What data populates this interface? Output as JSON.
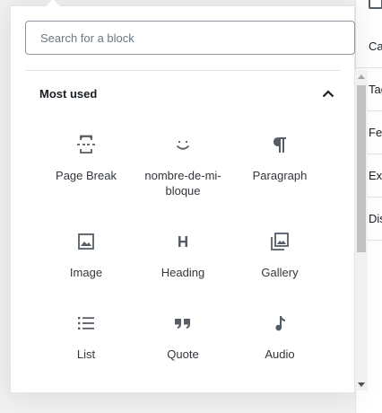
{
  "search": {
    "placeholder": "Search for a block",
    "value": ""
  },
  "panel": {
    "title": "Most used",
    "expanded": true
  },
  "blocks": [
    {
      "label": "Page Break",
      "icon": "page-break-icon"
    },
    {
      "label": "nombre-de-mi-bloque",
      "icon": "smiley-icon"
    },
    {
      "label": "Paragraph",
      "icon": "paragraph-icon"
    },
    {
      "label": "Image",
      "icon": "image-icon"
    },
    {
      "label": "Heading",
      "icon": "heading-icon"
    },
    {
      "label": "Gallery",
      "icon": "gallery-icon"
    },
    {
      "label": "List",
      "icon": "list-icon"
    },
    {
      "label": "Quote",
      "icon": "quote-icon"
    },
    {
      "label": "Audio",
      "icon": "audio-icon"
    }
  ],
  "sidebar": {
    "items": [
      {
        "label": "Categories"
      },
      {
        "label": "Tags"
      },
      {
        "label": "Featured image"
      },
      {
        "label": "Excerpt"
      },
      {
        "label": "Discussion"
      }
    ]
  },
  "colors": {
    "text": "#32373c",
    "border": "#e2e4e7",
    "icon": "#555d66"
  }
}
